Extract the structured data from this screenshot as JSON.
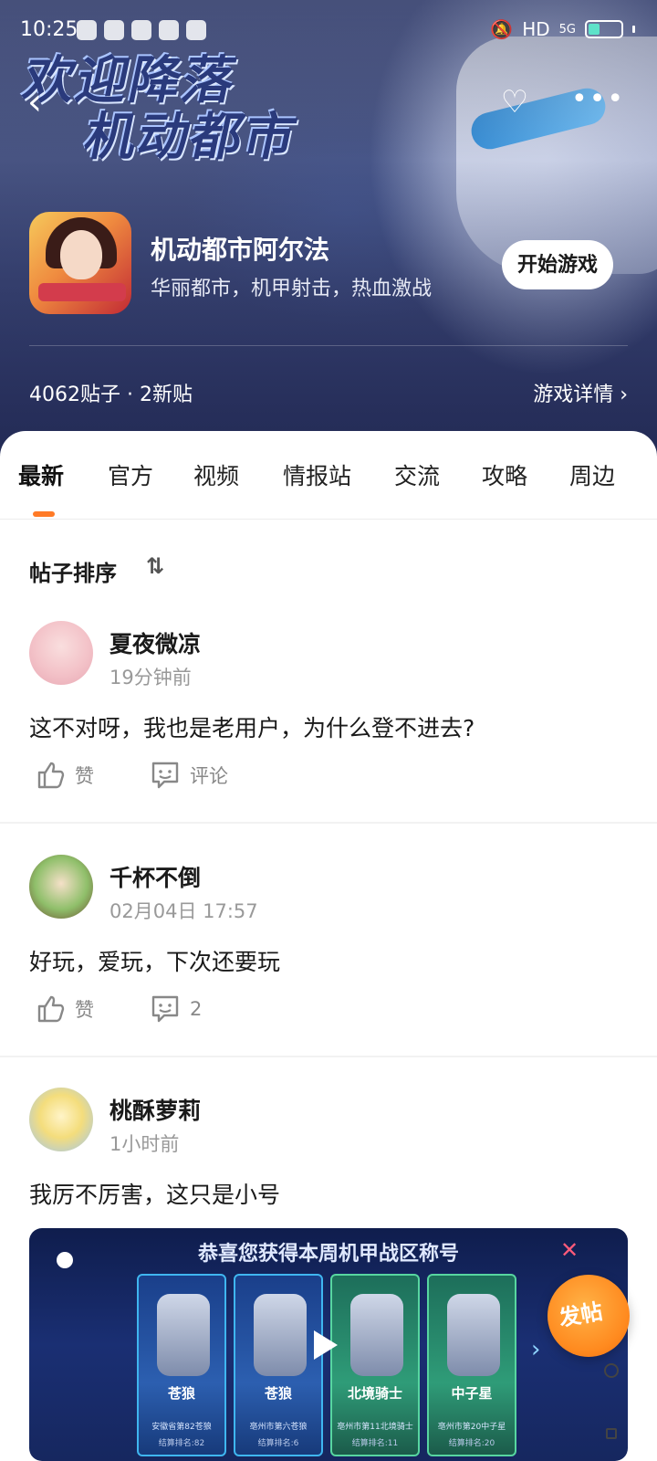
{
  "status_bar": {
    "time": "10:25",
    "network": "HD",
    "signal": "5G"
  },
  "header": {
    "banner_line1": "欢迎降落",
    "banner_line2": "机动都市",
    "back_icon": "back-icon",
    "favorite_icon": "heart-plus-icon",
    "more_icon": "more-icon"
  },
  "game": {
    "name": "机动都市阿尔法",
    "description": "华丽都市，机甲射击，热血激战",
    "start_label": "开始游戏",
    "stats": "4062贴子 · 2新贴",
    "details_label": "游戏详情 ›"
  },
  "tabs": [
    {
      "label": "最新",
      "active": true
    },
    {
      "label": "官方"
    },
    {
      "label": "视频"
    },
    {
      "label": "情报站"
    },
    {
      "label": "交流"
    },
    {
      "label": "攻略"
    },
    {
      "label": "周边"
    }
  ],
  "sort": {
    "label": "帖子排序",
    "icon": "⇅"
  },
  "posts": [
    {
      "user": "夏夜微凉",
      "time": "19分钟前",
      "text": "这不对呀，我也是老用户，为什么登不进去?",
      "like_label": "赞",
      "comment_label": "评论"
    },
    {
      "user": "千杯不倒",
      "time": "02月04日 17:57",
      "text": "好玩，爱玩，下次还要玩",
      "like_label": "赞",
      "comment_label": "2"
    },
    {
      "user": "桃酥萝莉",
      "time": "1小时前",
      "text": "我厉不厉害，这只是小号"
    }
  ],
  "screenshot": {
    "title": "恭喜您获得本周机甲战区称号",
    "cards": [
      {
        "name": "苍狼",
        "sub": "安徽省第82苍狼",
        "rank": "结算排名:82"
      },
      {
        "name": "苍狼",
        "sub": "亳州市第六苍狼",
        "rank": "结算排名:6"
      },
      {
        "name": "北境骑士",
        "sub": "亳州市第11北境骑士",
        "rank": "结算排名:11"
      },
      {
        "name": "中子星",
        "sub": "亳州市第20中子星",
        "rank": "结算排名:20"
      }
    ]
  },
  "fab": {
    "label": "发帖"
  }
}
